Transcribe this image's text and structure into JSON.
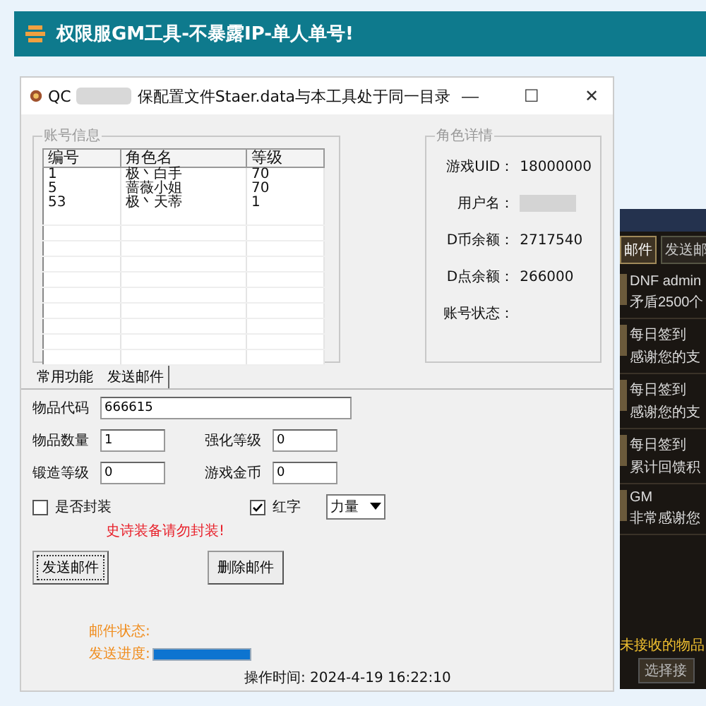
{
  "banner": {
    "title": "权限服GM工具-不暴露IP-单人单号!"
  },
  "window": {
    "title_prefix": "QC",
    "title": "保配置文件Staer.data与本工具处于同一目录",
    "controls": [
      "—",
      "☐",
      "✕"
    ]
  },
  "accounts": {
    "legend": "账号信息",
    "columns": [
      "编号",
      "角色名",
      "等级"
    ],
    "rows": [
      [
        "1",
        "极丶白手",
        "70"
      ],
      [
        "5",
        "蔷薇小姐",
        "70"
      ],
      [
        "53",
        "极丶天蒂",
        "1"
      ]
    ]
  },
  "details": {
    "legend": "角色详情",
    "fields": [
      {
        "label": "游戏UID：",
        "kind": "text",
        "value": "18000000"
      },
      {
        "label": "用户名：",
        "kind": "redacted"
      },
      {
        "label": "D币余额：",
        "kind": "text",
        "value": "2717540"
      },
      {
        "label": "D点余额：",
        "kind": "text",
        "value": "266000"
      },
      {
        "label": "账号状态：",
        "kind": "empty"
      }
    ]
  },
  "tabs": [
    {
      "label": "常用功能",
      "selected": false
    },
    {
      "label": "发送邮件",
      "selected": true
    }
  ],
  "mail_form": {
    "item_code": {
      "label": "物品代码",
      "value": "666615"
    },
    "pairs": [
      [
        {
          "label": "物品数量",
          "value": "1"
        },
        {
          "label": "强化等级",
          "value": "0"
        }
      ],
      [
        {
          "label": "锻造等级",
          "value": "0"
        },
        {
          "label": "游戏金币",
          "value": "0"
        }
      ]
    ],
    "checkboxes": [
      {
        "label": "是否封装",
        "checked": false
      },
      {
        "label": "红字",
        "checked": true
      }
    ],
    "dropdown": {
      "value": "力量"
    },
    "warning": "史诗装备请勿封装!",
    "buttons": [
      {
        "label": "发送邮件",
        "focused": true
      },
      {
        "label": "删除邮件",
        "focused": false
      }
    ],
    "mail_status": "邮件状态:",
    "progress": {
      "label": "发送进度:",
      "level": 1
    },
    "op_time": "操作时间: 2024-4-19 16:22:10"
  },
  "game_panel": {
    "tabs": [
      {
        "label": "邮件",
        "selected": true
      },
      {
        "label": "发送邮",
        "selected": false
      }
    ],
    "mails": [
      {
        "sender": "DNF admin",
        "subject": "矛盾2500个"
      },
      {
        "sender": "每日签到",
        "subject": "感谢您的支"
      },
      {
        "sender": "每日签到",
        "subject": "感谢您的支"
      },
      {
        "sender": "每日签到",
        "subject": "累计回馈积"
      },
      {
        "sender": "GM",
        "subject": "非常感谢您"
      }
    ],
    "footer": "未接收的物品",
    "action": "选择接"
  }
}
